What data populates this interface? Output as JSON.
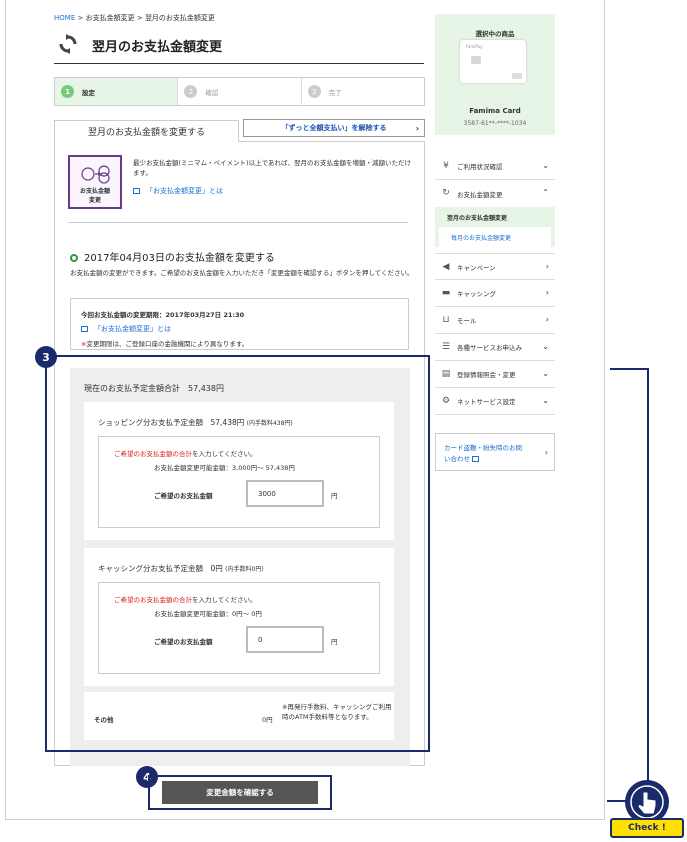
{
  "breadcrumb": {
    "home": "HOME",
    "sep": ">",
    "item1": "お支払金額変更",
    "item2": "翌月のお支払金額変更"
  },
  "page_title": "翌月のお支払金額変更",
  "steps": [
    {
      "num": "1",
      "label": "設定"
    },
    {
      "num": "2",
      "label": "確認"
    },
    {
      "num": "3",
      "label": "完了"
    }
  ],
  "tab_label": "翌月のお支払金額を変更する",
  "cancel_button": "「ずっと全額支払い」を解除する",
  "info": {
    "icon_label_1": "お支払金額",
    "icon_label_2": "変更",
    "text": "最少お支払金額(ミニマム・ペイメント)以上であれば、翌月のお支払金額を増額・減額いただけます。",
    "link": "「お支払金額変更」とは"
  },
  "section": {
    "title": "2017年04月03日のお支払金額を変更する",
    "desc": "お支払金額の変更ができます。ご希望のお支払金額を入力いただき「変更金額を確認する」ボタンを押してください。"
  },
  "deadline": {
    "text": "今回お支払金額の変更期限：2017年03月27日 21:30",
    "link": "「お支払金額変更」とは",
    "note_mark": "※",
    "note": "変更期限は、ご登録口座の金融機関により異なります。"
  },
  "badge3": "3",
  "badge4": "4",
  "total_label": "現在のお支払予定金額合計　57,438円",
  "shopping": {
    "heading": "ショッピング分お支払予定金額　57,438円",
    "fee": "(内手数料438円)",
    "instr_red": "ご希望のお支払金額の合計",
    "instr_rest": "を入力してください。",
    "range": "お支払金額変更可能金額：3,000円～ 57,438円",
    "field_label": "ご希望のお支払金額",
    "value": "3000",
    "yen": "円"
  },
  "cashing": {
    "heading": "キャッシング分お支払予定金額　0円",
    "fee": "(内手数料0円)",
    "instr_red": "ご希望のお支払金額の合計",
    "instr_rest": "を入力してください。",
    "range": "お支払金額変更可能金額：0円～ 0円",
    "field_label": "ご希望のお支払金額",
    "value": "0",
    "yen": "円"
  },
  "other": {
    "label": "その他",
    "amount": "0円",
    "note": "※再発行手数料、キャッシングご利用時のATM手数料等となります。"
  },
  "submit_label": "変更金額を確認する",
  "sidebar": {
    "selected_label": "選択中の商品",
    "card_brand": "FamiPay",
    "card_name": "Famima Card",
    "card_number": "3587-61**-****-1034",
    "menu": [
      {
        "icon": "yen-icon",
        "label": "ご利用状況確認"
      },
      {
        "icon": "refresh-icon",
        "label": "お支払金額変更"
      },
      {
        "icon": "megaphone-icon",
        "label": "キャンペーン"
      },
      {
        "icon": "card-icon",
        "label": "キャッシング"
      },
      {
        "icon": "cart-icon",
        "label": "モール"
      },
      {
        "icon": "list-icon",
        "label": "各種サービスお申込み"
      },
      {
        "icon": "document-icon",
        "label": "登録情報照会・変更"
      },
      {
        "icon": "gear-icon",
        "label": "ネットサービス設定"
      }
    ],
    "submenu": [
      "翌月のお支払金額変更",
      "毎月のお支払金額変更"
    ],
    "help": "カード盗難・紛失時のお問い合わせ"
  },
  "check_label": "Check !",
  "colors": {
    "accent_green": "#e6f5e6",
    "navy": "#1a2a6a",
    "link": "#1a6fd0",
    "red": "#e02020",
    "yellow": "#ffe000"
  }
}
